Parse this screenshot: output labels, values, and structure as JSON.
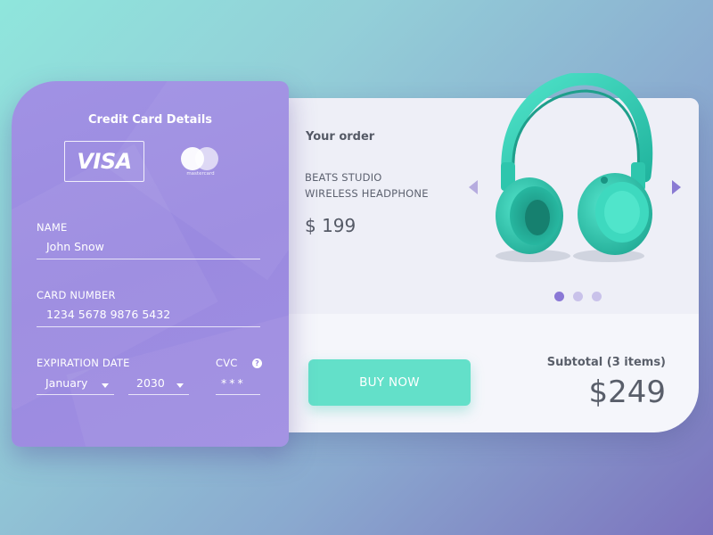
{
  "card_panel": {
    "title": "Credit Card Details",
    "visa_label": "VISA",
    "mastercard_label": "mastercard",
    "name": {
      "label": "NAME",
      "value": "John Snow"
    },
    "card_number": {
      "label": "CARD NUMBER",
      "value": "1234 5678 9876 5432"
    },
    "expiration": {
      "label": "EXPIRATION DATE",
      "month": "January",
      "year": "2030"
    },
    "cvc": {
      "label": "CVC",
      "value": "***",
      "help_icon": "?"
    }
  },
  "order": {
    "title": "Your order",
    "product_line1": "BEATS STUDIO",
    "product_line2": "WIRELESS HEADPHONE",
    "price": "$ 199",
    "carousel_active_index": 0,
    "carousel_count": 3,
    "buy_label": "BUY NOW",
    "subtotal_label": "Subtotal (3 items)",
    "subtotal_value": "$249"
  },
  "colors": {
    "card_purple": "#9a8ae0",
    "accent_teal": "#63e0c9",
    "dot_active": "#8a78d6",
    "dot_inactive": "#c9c2ea",
    "headphone_teal": "#3dd6bd"
  },
  "icons": [
    "visa-logo",
    "mastercard-logo",
    "help-icon",
    "arrow-left-icon",
    "arrow-right-icon"
  ]
}
